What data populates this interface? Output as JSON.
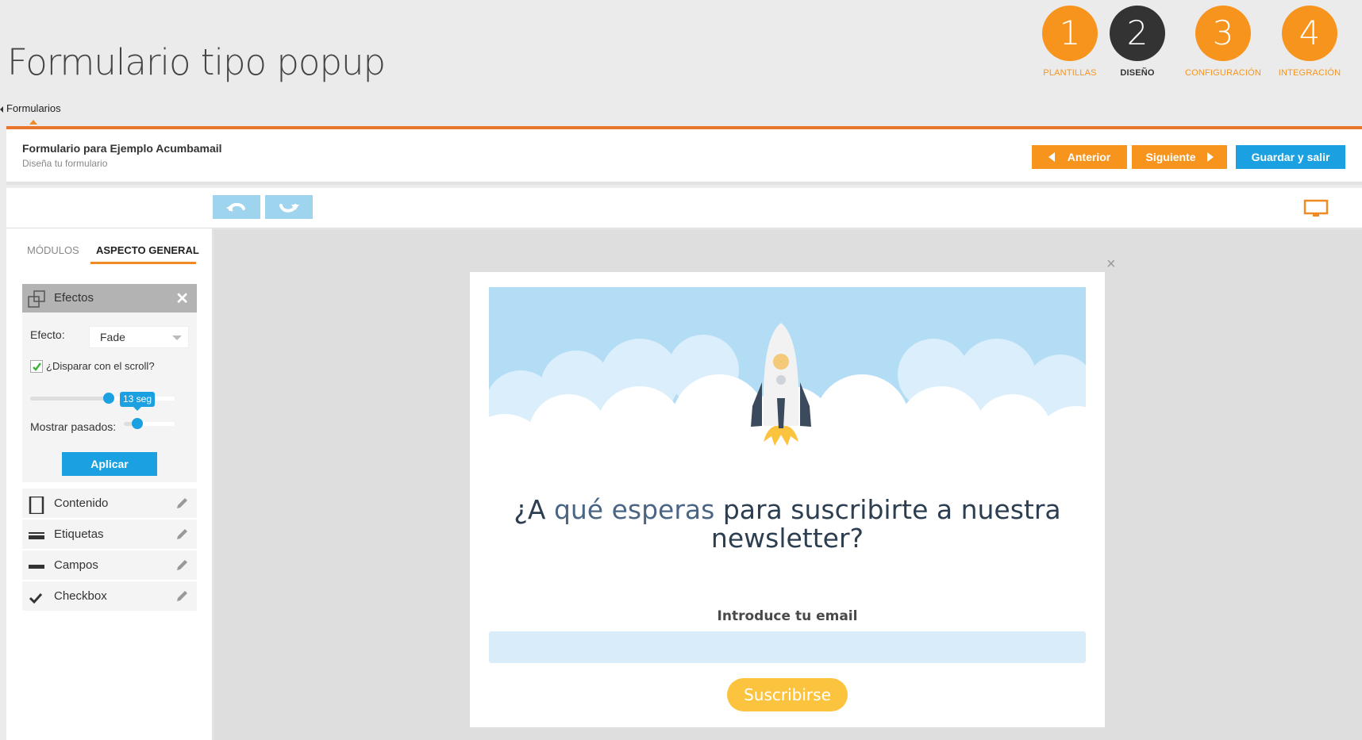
{
  "page": {
    "title": "Formulario tipo popup"
  },
  "breadcrumb": {
    "label": "Formularios"
  },
  "steps": [
    {
      "number": "1",
      "label": "PLANTILLAS"
    },
    {
      "number": "2",
      "label": "DISEÑO"
    },
    {
      "number": "3",
      "label": "CONFIGURACIÓN"
    },
    {
      "number": "4",
      "label": "INTEGRACIÓN"
    }
  ],
  "header": {
    "form_name": "Formulario para Ejemplo Acumbamail",
    "subtitle": "Diseña tu formulario",
    "prev_label": "Anterior",
    "next_label": "Siguiente",
    "save_label": "Guardar y salir"
  },
  "sidebar": {
    "tabs": [
      {
        "label": "MÓDULOS"
      },
      {
        "label": "ASPECTO GENERAL"
      }
    ],
    "effects_panel": {
      "title": "Efectos",
      "effect_label": "Efecto:",
      "effect_value": "Fade",
      "scroll_checkbox_label": "¿Disparar con el scroll?",
      "scroll_checked": true,
      "show_past_label": "Mostrar pasados:",
      "tooltip": "13 seg",
      "apply_label": "Aplicar"
    },
    "modules": [
      {
        "label": "Contenido"
      },
      {
        "label": "Etiquetas"
      },
      {
        "label": "Campos"
      },
      {
        "label": "Checkbox"
      }
    ]
  },
  "popup": {
    "close": "×",
    "headline_part1": "¿A ",
    "headline_highlight": "qué esperas",
    "headline_part2": " para suscribirte a nuestra newsletter?",
    "email_label": "Introduce tu email",
    "email_value": "",
    "subscribe_label": "Suscribirse"
  },
  "colors": {
    "accent_orange": "#f7941d",
    "accent_blue": "#1ba1e2",
    "subscribe_yellow": "#fcc43e",
    "hero_sky": "#b3dcf5"
  }
}
